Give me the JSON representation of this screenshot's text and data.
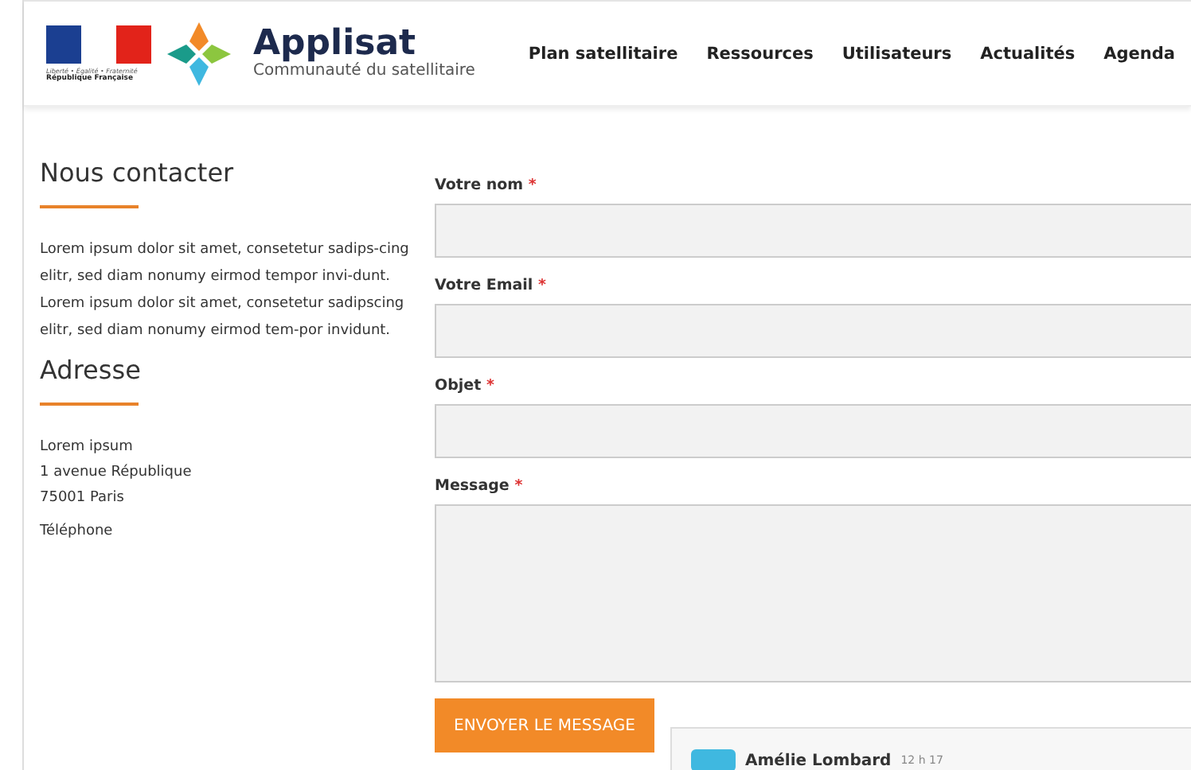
{
  "header": {
    "emblem_motto": "Liberté • Égalité • Fraternité",
    "emblem_name": "République Française",
    "brand": "Applisat",
    "tagline": "Communauté du satellitaire",
    "nav": [
      {
        "label": "Plan satellitaire"
      },
      {
        "label": "Ressources"
      },
      {
        "label": "Utilisateurs"
      },
      {
        "label": "Actualités"
      },
      {
        "label": "Agenda"
      }
    ]
  },
  "sidebar": {
    "contact_title": "Nous contacter",
    "contact_text": "Lorem ipsum dolor sit amet, consetetur sadips-cing elitr, sed diam nonumy eirmod tempor invi-dunt. Lorem ipsum dolor sit amet, consetetur sadipscing elitr, sed diam nonumy eirmod tem-por invidunt.",
    "address_title": "Adresse",
    "address_lines": [
      "Lorem ipsum",
      "1 avenue République",
      "75001 Paris"
    ],
    "phone": "Téléphone"
  },
  "form": {
    "fields": [
      {
        "label": "Votre nom",
        "required_mark": "*",
        "kind": "input"
      },
      {
        "label": "Votre Email",
        "required_mark": "*",
        "kind": "input"
      },
      {
        "label": "Objet",
        "required_mark": "*",
        "kind": "input"
      },
      {
        "label": "Message",
        "required_mark": "*",
        "kind": "textarea"
      }
    ],
    "submit": "ENVOYER LE MESSAGE"
  },
  "chat": {
    "author": "Amélie Lombard",
    "time": "12 h 17"
  }
}
